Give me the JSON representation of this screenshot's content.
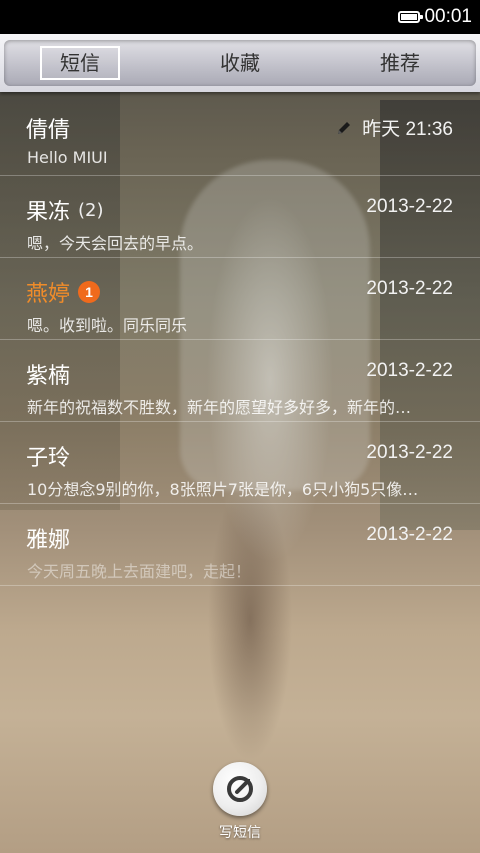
{
  "status_bar": {
    "time": "00:01"
  },
  "tabs": [
    {
      "label": "短信",
      "selected": true
    },
    {
      "label": "收藏",
      "selected": false
    },
    {
      "label": "推荐",
      "selected": false
    }
  ],
  "messages": [
    {
      "name": "倩倩",
      "count": "",
      "badge": "",
      "date": "昨天 21:36",
      "snippet": "Hello MIUI",
      "draft": true
    },
    {
      "name": "果冻",
      "count": "(2)",
      "badge": "",
      "date": "2013-2-22",
      "snippet": "嗯，今天会回去的早点。"
    },
    {
      "name": "燕婷",
      "count": "",
      "badge": "1",
      "date": "2013-2-22",
      "snippet": "嗯。收到啦。同乐同乐"
    },
    {
      "name": "紫楠",
      "count": "",
      "badge": "",
      "date": "2013-2-22",
      "snippet": "新年的祝福数不胜数，新年的愿望好多好多，新年的…"
    },
    {
      "name": "子玲",
      "count": "",
      "badge": "",
      "date": "2013-2-22",
      "snippet": "10分想念9别的你，8张照片7张是你，6只小狗5只像…"
    },
    {
      "name": "雅娜",
      "count": "",
      "badge": "",
      "date": "2013-2-22",
      "snippet": "今天周五晚上去面建吧，走起！"
    }
  ],
  "compose": {
    "label": "写短信"
  },
  "colors": {
    "accent": "#f08c2a",
    "badge": "#f06a1c"
  },
  "icons": {
    "compose": "compose-icon",
    "draft": "pencil-icon",
    "battery": "battery-icon"
  }
}
